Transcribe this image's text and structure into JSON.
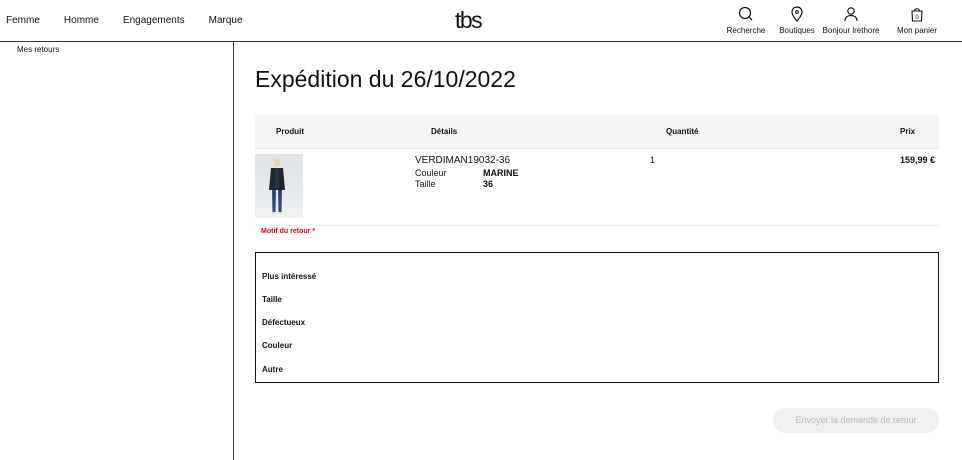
{
  "header": {
    "nav": [
      "Femme",
      "Homme",
      "Engagements",
      "Marque"
    ],
    "logo_text": "tbs",
    "actions": {
      "search": "Recherche",
      "stores": "Boutiques",
      "account": "Bonjour lrethore",
      "cart": "Mon panier",
      "cart_count": "0"
    }
  },
  "sidebar": {
    "link": "Mes retours"
  },
  "main": {
    "title": "Expédition du 26/10/2022",
    "table": {
      "headers": {
        "product": "Produit",
        "details": "Détails",
        "quantity": "Quantité",
        "price": "Prix"
      },
      "row": {
        "reference": "VERDIMAN19032-36",
        "color_label": "Couleur",
        "color_value": "MARINE",
        "size_label": "Taille",
        "size_value": "36",
        "quantity": "1",
        "price": "159,99 €"
      }
    },
    "motif_label": "Motif du retour *",
    "options": [
      "Plus intéressé",
      "Taille",
      "Défectueux",
      "Couleur",
      "Autre"
    ],
    "submit_label": "Envoyer la demande de retour"
  },
  "colors": {
    "accent_required": "#d0021b",
    "header_band": "#f5f5f5",
    "disabled_button": "#efefef"
  }
}
